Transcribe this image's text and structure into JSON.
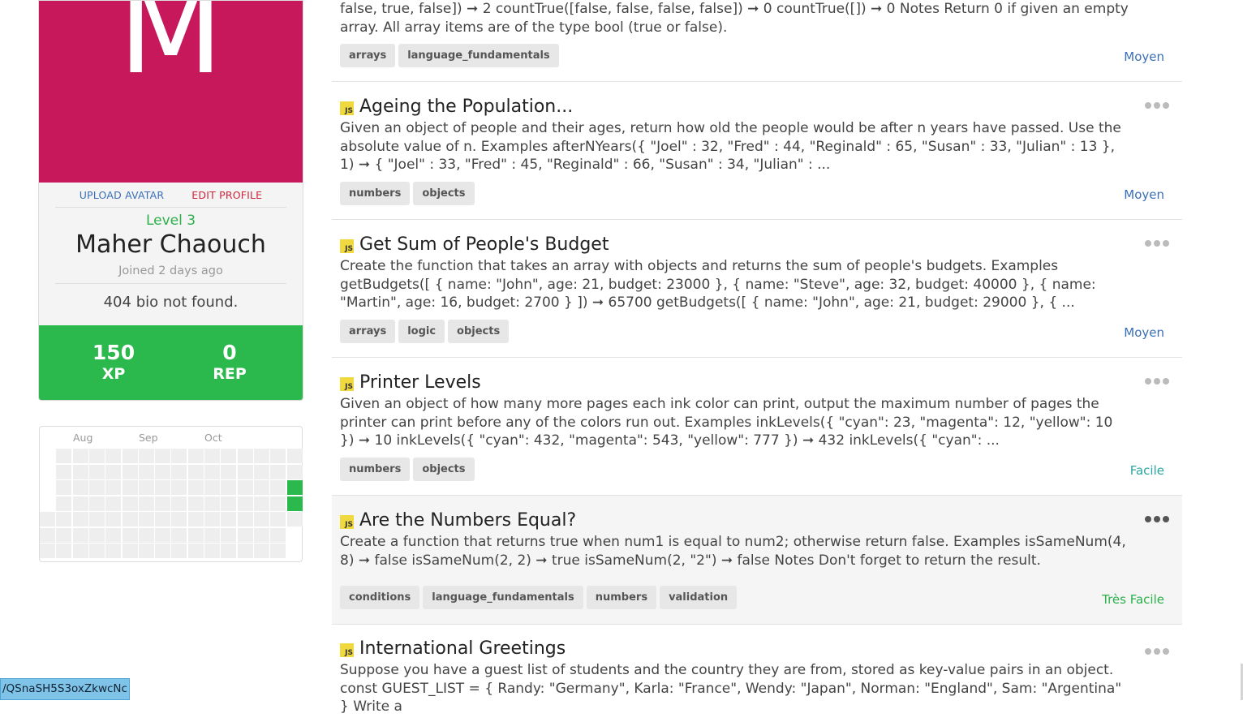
{
  "profile": {
    "avatar_letter": "M",
    "upload_avatar": "UPLOAD AVATAR",
    "edit_profile": "EDIT PROFILE",
    "level": "Level 3",
    "name": "Maher Chaouch",
    "joined": "Joined 2 days ago",
    "bio": "404 bio not found.",
    "xp_value": "150",
    "xp_label": "XP",
    "rep_value": "0",
    "rep_label": "REP",
    "avatar_color": "#c6185a"
  },
  "heatmap": {
    "months": [
      "Aug",
      "Sep",
      "Oct"
    ],
    "active_color": "#2bb84d"
  },
  "challenges": [
    {
      "language": "JS",
      "title": "",
      "description": "false, true, false]) ➞ 2 countTrue([false, false, false, false]) ➞ 0 countTrue([]) ➞ 0 Notes Return 0 if given an empty array. All array items are of the type bool (true or false).",
      "tags": [
        "arrays",
        "language_fundamentals"
      ],
      "difficulty": "Moyen"
    },
    {
      "language": "JS",
      "title": "Ageing the Population...",
      "description": "Given an object of people and their ages, return how old the people would be after n years have passed. Use the absolute value of n. Examples afterNYears({ \"Joel\" : 32, \"Fred\" : 44, \"Reginald\" : 65, \"Susan\" : 33, \"Julian\" : 13 }, 1) ➞ { \"Joel\" : 33, \"Fred\" : 45, \"Reginald\" : 66, \"Susan\" : 34, \"Julian\" : ...",
      "tags": [
        "numbers",
        "objects"
      ],
      "difficulty": "Moyen"
    },
    {
      "language": "JS",
      "title": "Get Sum of People's Budget",
      "description": "Create the function that takes an array with objects and returns the sum of people's budgets. Examples getBudgets([ { name: \"John\", age: 21, budget: 23000 }, { name: \"Steve\", age: 32, budget: 40000 }, { name: \"Martin\", age: 16, budget: 2700 } ]) ➞ 65700 getBudgets([ { name: \"John\", age: 21, budget: 29000 }, { ...",
      "tags": [
        "arrays",
        "logic",
        "objects"
      ],
      "difficulty": "Moyen"
    },
    {
      "language": "JS",
      "title": "Printer Levels",
      "description": "Given an object of how many more pages each ink color can print, output the maximum number of pages the printer can print before any of the colors run out. Examples inkLevels({ \"cyan\": 23, \"magenta\": 12, \"yellow\": 10 }) ➞ 10 inkLevels({ \"cyan\": 432, \"magenta\": 543, \"yellow\": 777 }) ➞ 432 inkLevels({ \"cyan\": ...",
      "tags": [
        "numbers",
        "objects"
      ],
      "difficulty": "Facile"
    },
    {
      "language": "JS",
      "title": "Are the Numbers Equal?",
      "description": "Create a function that returns true when num1 is equal to num2; otherwise return false. Examples isSameNum(4, 8) ➞ false isSameNum(2, 2) ➞ true isSameNum(2, \"2\") ➞ false Notes Don't forget to return the result.",
      "tags": [
        "conditions",
        "language_fundamentals",
        "numbers",
        "validation"
      ],
      "difficulty": "Très Facile"
    },
    {
      "language": "JS",
      "title": "International Greetings",
      "description": "Suppose you have a guest list of students and the country they are from, stored as key-value pairs in an object. const GUEST_LIST = { Randy: \"Germany\", Karla: \"France\", Wendy: \"Japan\", Norman: \"England\", Sam: \"Argentina\" } Write a",
      "tags": [],
      "difficulty": ""
    }
  ],
  "status_bar": {
    "url": "/QSnaSH5S3oxZkwcNc"
  }
}
